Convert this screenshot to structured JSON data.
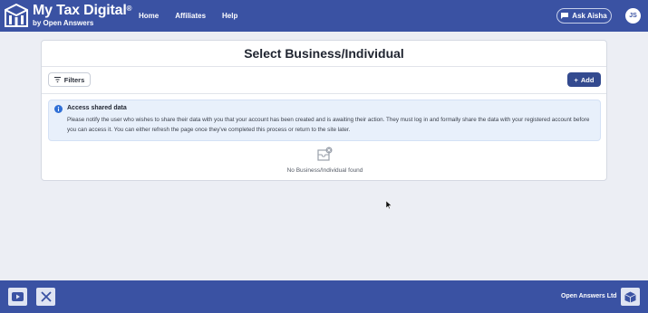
{
  "header": {
    "brand_title": "My Tax Digital",
    "brand_mark": "®",
    "brand_subtitle": "by Open Answers",
    "nav": [
      "Home",
      "Affiliates",
      "Help"
    ],
    "ask_label": "Ask Aisha",
    "avatar_initials": "JS",
    "icons": {
      "logo": "building-logo-icon",
      "ask": "chat-icon"
    }
  },
  "main": {
    "title": "Select Business/Individual",
    "filters_label": "Filters",
    "add_label": "Add",
    "alert": {
      "title": "Access shared data",
      "text": "Please notify the user who wishes to share their data with you that your account has been created and is awaiting their action. They must log in and formally share the data with your registered account before you can access it. You can either refresh the page once they've completed this process or return to the site later."
    },
    "empty_message": "No Business/Individual found"
  },
  "footer": {
    "company": "Open Answers Ltd",
    "icons": [
      "youtube-icon",
      "x-icon",
      "box-logo-icon"
    ]
  },
  "colors": {
    "brand_blue": "#3a52a3",
    "add_button": "#334a8f",
    "alert_bg": "#e8f0fb",
    "page_bg": "#eceef4"
  }
}
